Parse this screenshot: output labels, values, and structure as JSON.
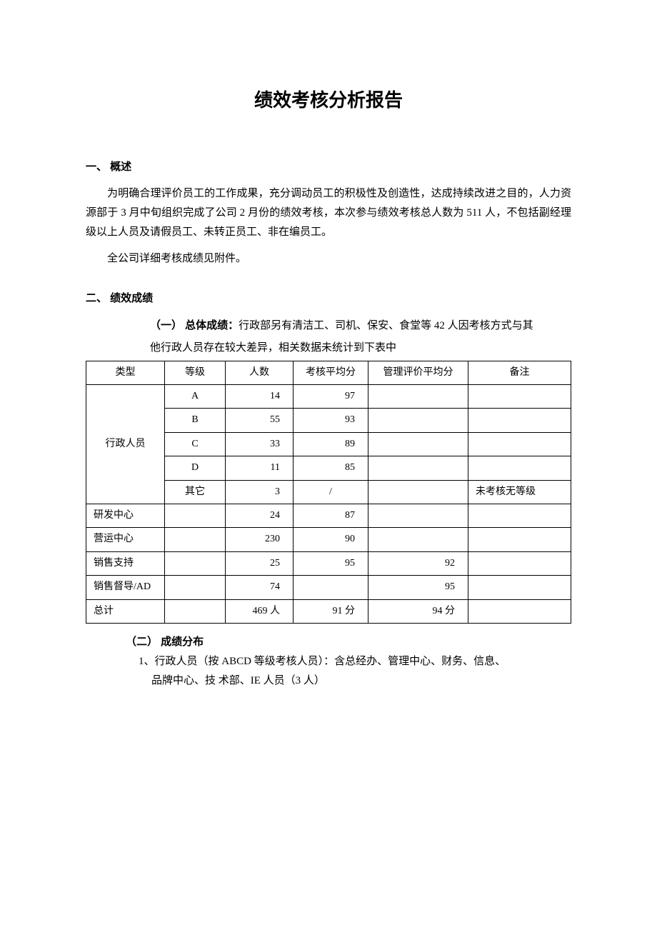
{
  "title": "绩效考核分析报告",
  "section1": {
    "heading": "一、 概述",
    "p1": "为明确合理评价员工的工作成果，充分调动员工的积极性及创造性，达成持续改进之目的，人力资源部于 3 月中旬组织完成了公司 2 月份的绩效考核，本次参与绩效考核总人数为 511 人，不包括副经理级以上人员及请假员工、未转正员工、非在编员工。",
    "p2": "全公司详细考核成绩见附件。"
  },
  "section2": {
    "heading": "二、 绩效成绩",
    "overall_label": "（一） 总体成绩：",
    "overall_text1": "行政部另有清洁工、司机、保安、食堂等 42 人因考核方式与其",
    "overall_text2": "他行政人员存在较大差异，相关数据未统计到下表中",
    "table": {
      "headers": [
        "类型",
        "等级",
        "人数",
        "考核平均分",
        "管理评价平均分",
        "备注"
      ],
      "rows": [
        {
          "type": "行政人员",
          "grade": "A",
          "count": "14",
          "avg": "97",
          "mgr": "",
          "note": ""
        },
        {
          "type": "",
          "grade": "B",
          "count": "55",
          "avg": "93",
          "mgr": "",
          "note": ""
        },
        {
          "type": "",
          "grade": "C",
          "count": "33",
          "avg": "89",
          "mgr": "",
          "note": ""
        },
        {
          "type": "",
          "grade": "D",
          "count": "11",
          "avg": "85",
          "mgr": "",
          "note": ""
        },
        {
          "type": "",
          "grade": "其它",
          "count": "3",
          "avg": "/",
          "mgr": "",
          "note": "未考核无等级"
        },
        {
          "type": "研发中心",
          "grade": "",
          "count": "24",
          "avg": "87",
          "mgr": "",
          "note": ""
        },
        {
          "type": "营运中心",
          "grade": "",
          "count": "230",
          "avg": "90",
          "mgr": "",
          "note": ""
        },
        {
          "type": "销售支持",
          "grade": "",
          "count": "25",
          "avg": "95",
          "mgr": "92",
          "note": ""
        },
        {
          "type": "销售督导/AD",
          "grade": "",
          "count": "74",
          "avg": "",
          "mgr": "95",
          "note": ""
        },
        {
          "type": "总计",
          "grade": "",
          "count": "469 人",
          "avg": "91 分",
          "mgr": "94 分",
          "note": ""
        }
      ]
    },
    "dist_label": "（二） 成绩分布",
    "dist_line1": "1、行政人员（按 ABCD 等级考核人员）：含总经办、管理中心、财务、信息、",
    "dist_line2": "品牌中心、技 术部、IE 人员（3 人）"
  }
}
